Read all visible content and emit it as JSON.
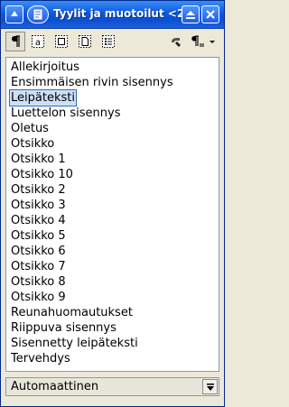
{
  "window": {
    "title": "Tyylit ja muotoilut <2>",
    "title_icon": "styles-icon"
  },
  "toolbar": {
    "tools": [
      {
        "name": "paragraph-styles-icon",
        "active": true
      },
      {
        "name": "character-styles-icon",
        "active": false
      },
      {
        "name": "frame-styles-icon",
        "active": false
      },
      {
        "name": "page-styles-icon",
        "active": false
      },
      {
        "name": "list-styles-icon",
        "active": false
      }
    ],
    "fill_format_icon": "fill-format-mode-icon",
    "new_style_icon": "new-style-from-selection-icon"
  },
  "styles": {
    "items": [
      "Allekirjoitus",
      "Ensimmäisen rivin sisennys",
      "Leipäteksti",
      "Luettelon sisennys",
      "Oletus",
      "Otsikko",
      "Otsikko 1",
      "Otsikko 10",
      "Otsikko 2",
      "Otsikko 3",
      "Otsikko 4",
      "Otsikko 5",
      "Otsikko 6",
      "Otsikko 7",
      "Otsikko 8",
      "Otsikko 9",
      "Reunahuomautukset",
      "Riippuva sisennys",
      "Sisennetty leipäteksti",
      "Tervehdys"
    ],
    "selected_index": 2
  },
  "filter": {
    "value": "Automaattinen"
  },
  "colors": {
    "titlebar": "#0a5ae0",
    "selection": "#cde0f7"
  }
}
